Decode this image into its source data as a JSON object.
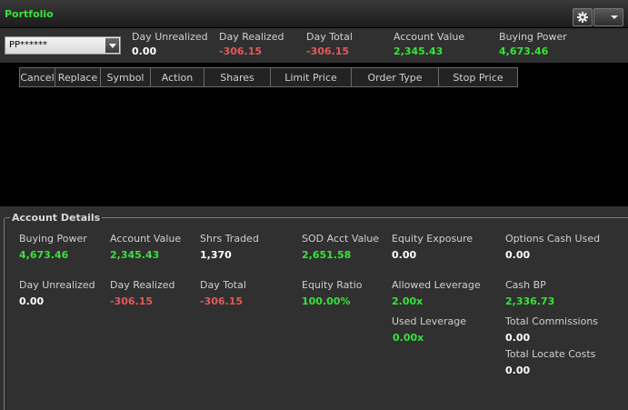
{
  "window": {
    "title": "Portfolio"
  },
  "toolbar": {
    "settings_icon": "gear-icon",
    "menu_icon": "chevron-down-icon"
  },
  "summary": {
    "account": "PP******",
    "day_unrealized": {
      "label": "Day Unrealized",
      "value": "0.00"
    },
    "day_realized": {
      "label": "Day Realized",
      "value": "-306.15"
    },
    "day_total": {
      "label": "Day Total",
      "value": "-306.15"
    },
    "account_value": {
      "label": "Account Value",
      "value": "2,345.43"
    },
    "buying_power": {
      "label": "Buying Power",
      "value": "4,673.46"
    }
  },
  "orders": {
    "columns": [
      "Cancel",
      "Replace",
      "Symbol",
      "Action",
      "Shares",
      "Limit Price",
      "Order Type",
      "Stop Price"
    ]
  },
  "account_details": {
    "title": "Account Details",
    "buying_power": {
      "label": "Buying Power",
      "value": "4,673.46"
    },
    "account_value": {
      "label": "Account Value",
      "value": "2,345.43"
    },
    "shrs_traded": {
      "label": "Shrs Traded",
      "value": "1,370"
    },
    "sod_acct_value": {
      "label": "SOD Acct Value",
      "value": "2,651.58"
    },
    "equity_exposure": {
      "label": "Equity Exposure",
      "value": "0.00"
    },
    "options_cash_used": {
      "label": "Options Cash Used",
      "value": "0.00"
    },
    "day_unrealized": {
      "label": "Day Unrealized",
      "value": "0.00"
    },
    "day_realized": {
      "label": "Day Realized",
      "value": "-306.15"
    },
    "day_total": {
      "label": "Day Total",
      "value": "-306.15"
    },
    "equity_ratio": {
      "label": "Equity Ratio",
      "value": "100.00%"
    },
    "allowed_leverage": {
      "label": "Allowed Leverage",
      "value": "2.00x"
    },
    "cash_bp": {
      "label": "Cash BP",
      "value": "2,336.73"
    },
    "used_leverage": {
      "label": "Used Leverage",
      "value": "0.00x"
    },
    "total_commissions": {
      "label": "Total Commissions",
      "value": "0.00"
    },
    "total_locate_costs": {
      "label": "Total Locate Costs",
      "value": "0.00"
    }
  },
  "colors": {
    "positive": "#38e23a",
    "negative": "#e05a5a",
    "neutral": "#ffffff",
    "panel": "#303030"
  }
}
